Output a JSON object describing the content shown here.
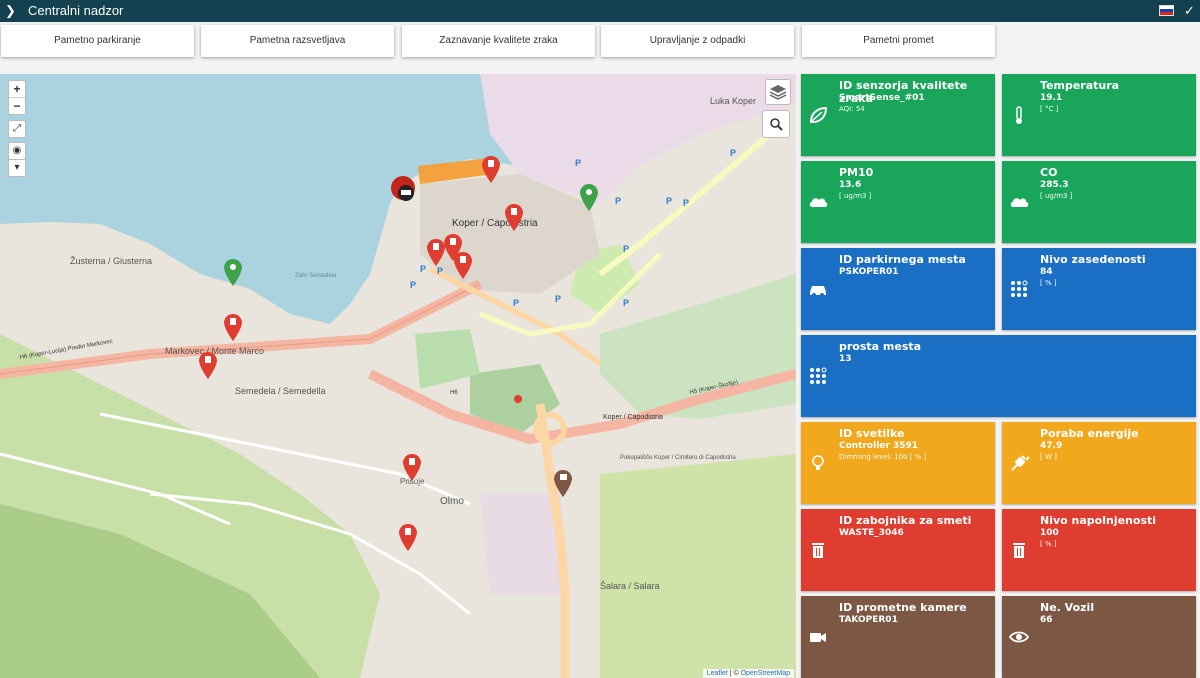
{
  "header": {
    "title": "Centralni nadzor"
  },
  "nav": {
    "parking": "Pametno parkiranje",
    "lighting": "Pametna razsvetljava",
    "air": "Zaznavanje kvalitete zraka",
    "waste": "Upravljanje z odpadki",
    "traffic": "Pametni promet"
  },
  "map": {
    "labels": {
      "luka": "Luka Koper",
      "koper": "Koper / Capodistria",
      "koper_center": "Koper / Capodistria",
      "zustema": "Žusterna / Giusterna",
      "markovec": "Markovec / Monte Marco",
      "semedela": "Semedela / Semedella",
      "olmo": "Olmo",
      "prisoje": "Prisoje",
      "salara": "Šalara / Salara",
      "zaliv": "Zaliv Semedela",
      "h6_1": "H6 (Koper-Lucija) Predor Markovec",
      "h6_2": "H6",
      "h5": "H5 (Koper-Škofije)",
      "pokopalisce": "Pokopališče Koper / Cimitero di Capodistria"
    },
    "attribution": {
      "leaflet": "Leaflet",
      "sep": " | © ",
      "osm": "OpenStreetMap"
    },
    "controls": {
      "zoom_in": "+",
      "zoom_out": "−"
    }
  },
  "tiles": {
    "air_id": {
      "label": "ID senzorja kvalitete zraka",
      "value": "SmartSense_#01",
      "sub": "AQI: 54"
    },
    "temperature": {
      "label": "Temperatura",
      "value": "19.1",
      "sub": "[ °C ]"
    },
    "pm10": {
      "label": "PM10",
      "value": "13.6",
      "sub": "[ ug/m3 ]"
    },
    "co": {
      "label": "CO",
      "value": "285.3",
      "sub": "[ ug/m3 ]"
    },
    "parking_id": {
      "label": "ID parkirnega mesta",
      "value": "PSKOPER01"
    },
    "occupancy": {
      "label": "Nivo zasedenosti",
      "value": "84",
      "sub": "[ % ]"
    },
    "free": {
      "label": "prosta mesta",
      "value": "13"
    },
    "light_id": {
      "label": "ID svetilke",
      "value": "Controller 3591",
      "sub": "Dimming level: 100 [ % ]"
    },
    "energy": {
      "label": "Poraba energije",
      "value": "47.9",
      "sub": "[ W ]"
    },
    "bin_id": {
      "label": "ID zabojnika za smeti",
      "value": "WASTE_3046"
    },
    "fill": {
      "label": "Nivo napolnjenosti",
      "value": "100",
      "sub": "[ % ]"
    },
    "camera_id": {
      "label": "ID prometne kamere",
      "value": "TAKOPER01"
    },
    "vehicles": {
      "label": "Ne. Vozil",
      "value": "66"
    }
  },
  "colors": {
    "green": "#1aa65a",
    "blue": "#1a6fc4",
    "orange": "#f2a81d",
    "red": "#e03d31",
    "brown": "#7c5744",
    "header": "#13414f"
  }
}
